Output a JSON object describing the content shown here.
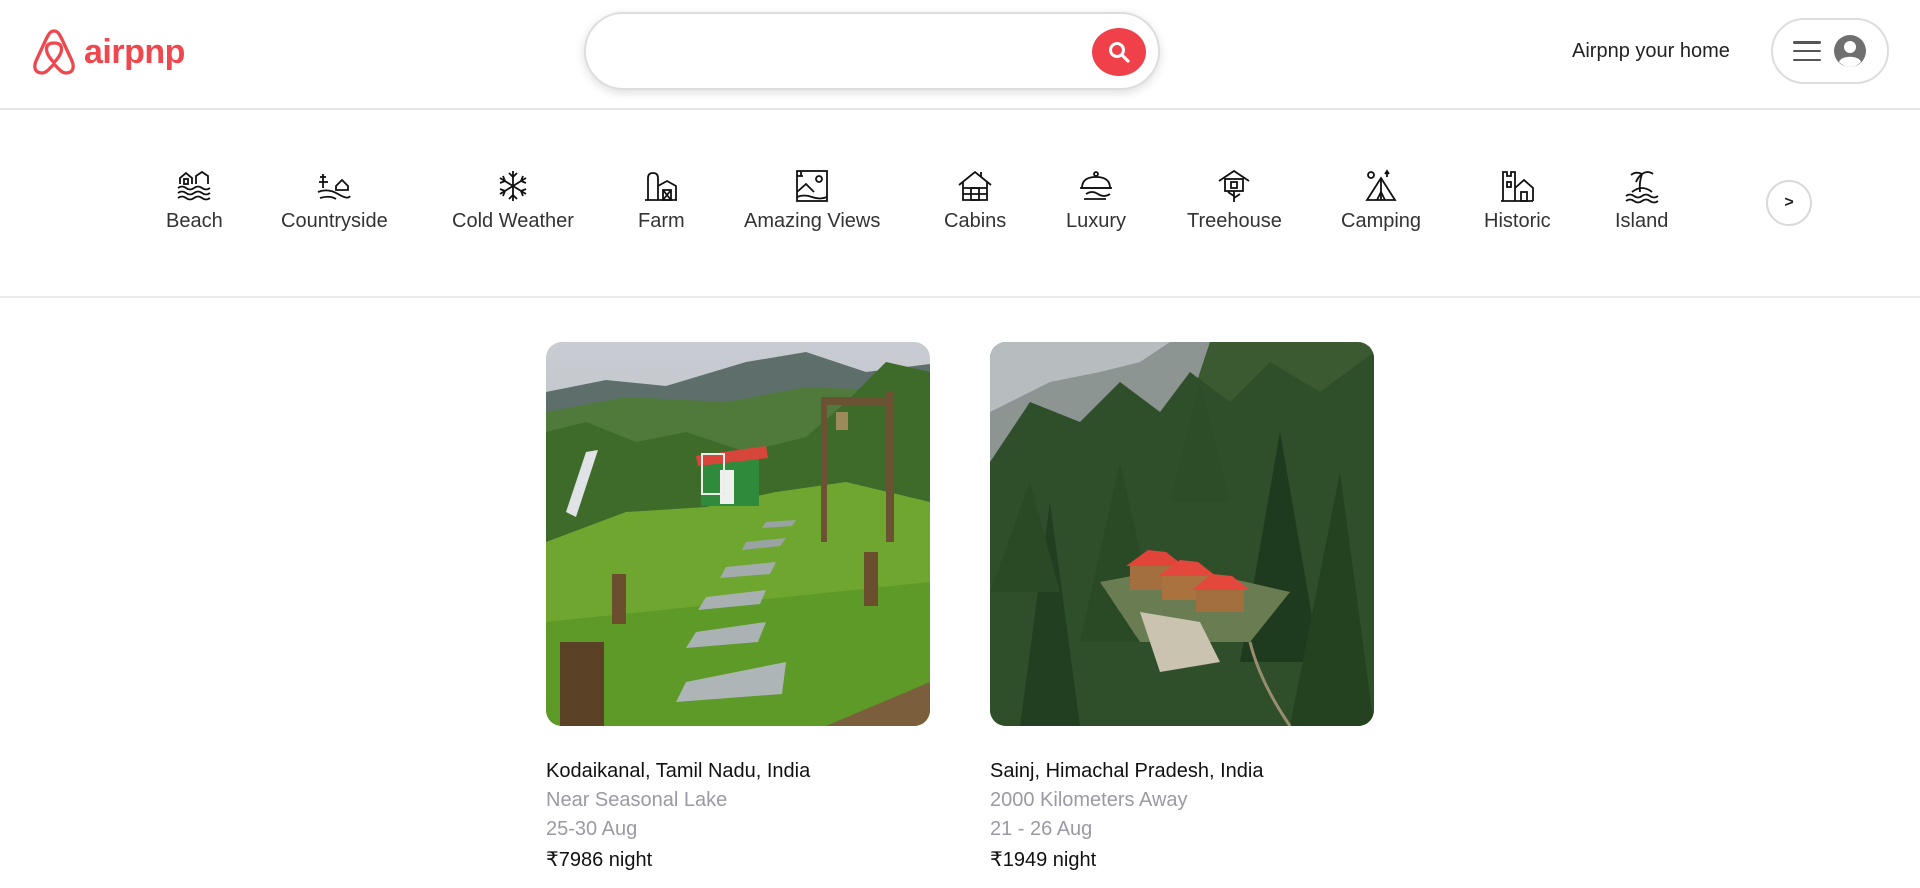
{
  "brand": {
    "name": "airpnp",
    "color": "#f0474f"
  },
  "search": {
    "placeholder": "",
    "value": "",
    "icon": "search-icon"
  },
  "header": {
    "host_link": "Airpnp your home",
    "menu_icon": "hamburger-icon",
    "avatar_icon": "user-avatar-icon"
  },
  "categories": {
    "items": [
      {
        "label": "Beach",
        "icon": "beach-icon"
      },
      {
        "label": "Countryside",
        "icon": "countryside-icon"
      },
      {
        "label": "Cold Weather",
        "icon": "snowflake-icon"
      },
      {
        "label": "Farm",
        "icon": "farm-icon"
      },
      {
        "label": "Amazing Views",
        "icon": "amazing-views-icon"
      },
      {
        "label": "Cabins",
        "icon": "cabin-icon"
      },
      {
        "label": "Luxury",
        "icon": "luxury-icon"
      },
      {
        "label": "Treehouse",
        "icon": "treehouse-icon"
      },
      {
        "label": "Camping",
        "icon": "camping-icon"
      },
      {
        "label": "Historic",
        "icon": "historic-icon"
      },
      {
        "label": "Island",
        "icon": "island-icon"
      }
    ],
    "next_label": ">"
  },
  "listings": [
    {
      "location": "Kodaikanal, Tamil Nadu, India",
      "subtitle": "Near Seasonal Lake",
      "dates": "25-30 Aug",
      "price": "₹7986",
      "price_unit": "night"
    },
    {
      "location": "Sainj, Himachal Pradesh, India",
      "subtitle": "2000 Kilometers Away",
      "dates": "21 - 26 Aug",
      "price": "₹1949",
      "price_unit": "night"
    }
  ]
}
